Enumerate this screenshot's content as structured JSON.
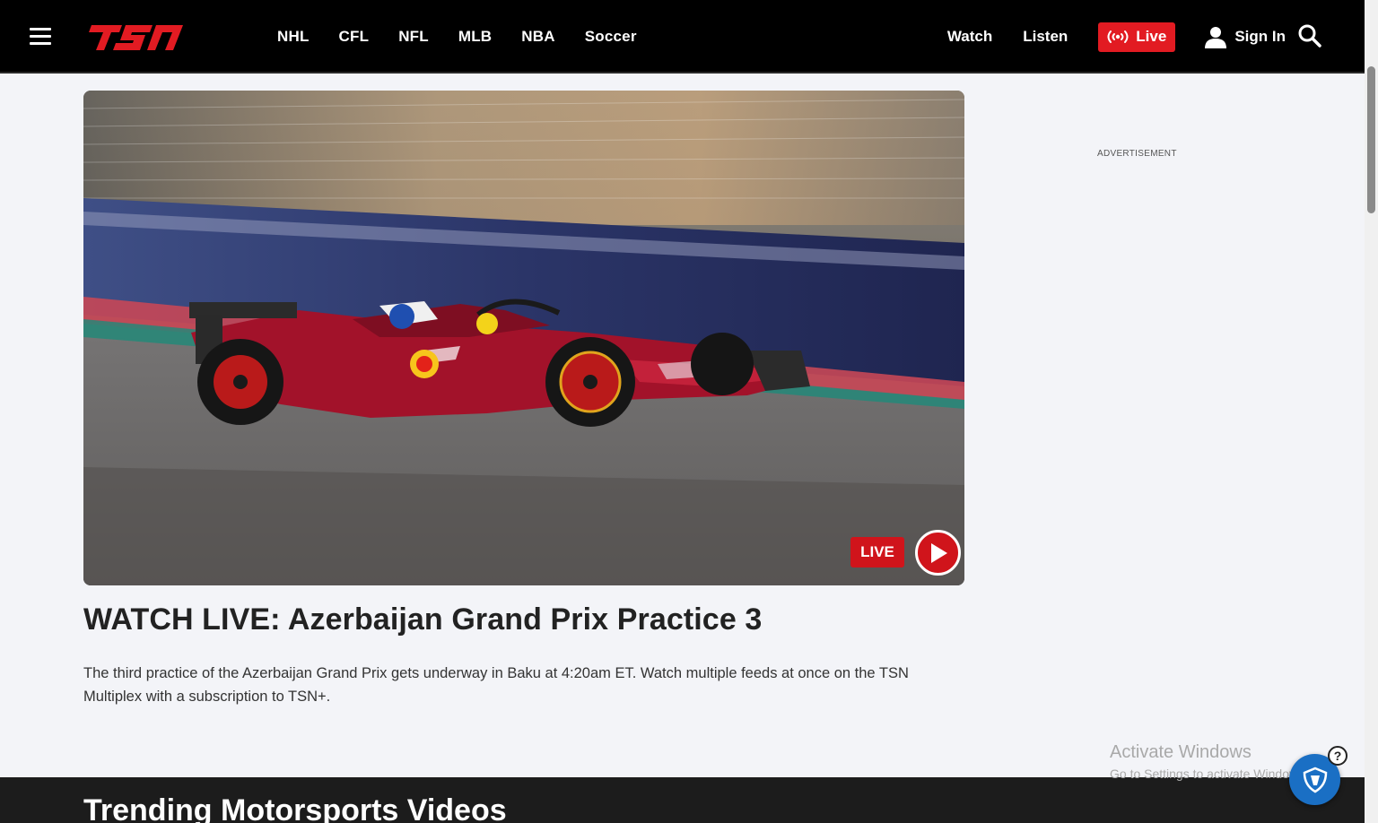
{
  "header": {
    "logo_text": "TSN",
    "nav_left": [
      "NHL",
      "CFL",
      "NFL",
      "MLB",
      "NBA",
      "Soccer"
    ],
    "watch_label": "Watch",
    "listen_label": "Listen",
    "live_label": "Live",
    "signin_label": "Sign In",
    "accent_color": "#e21b22"
  },
  "hero": {
    "live_badge": "LIVE",
    "headline": "WATCH LIVE: Azerbaijan Grand Prix Practice 3",
    "summary": "The third practice of the Azerbaijan Grand Prix gets underway in Baku at 4:20am ET. Watch multiple feeds at once on the TSN Multiplex with a subscription to TSN+."
  },
  "sidebar": {
    "ad_label": "ADVERTISEMENT"
  },
  "trending": {
    "title": "Trending Motorsports Videos"
  },
  "overlay": {
    "activate_title": "Activate Windows",
    "activate_sub": "Go to Settings to activate Windows."
  }
}
